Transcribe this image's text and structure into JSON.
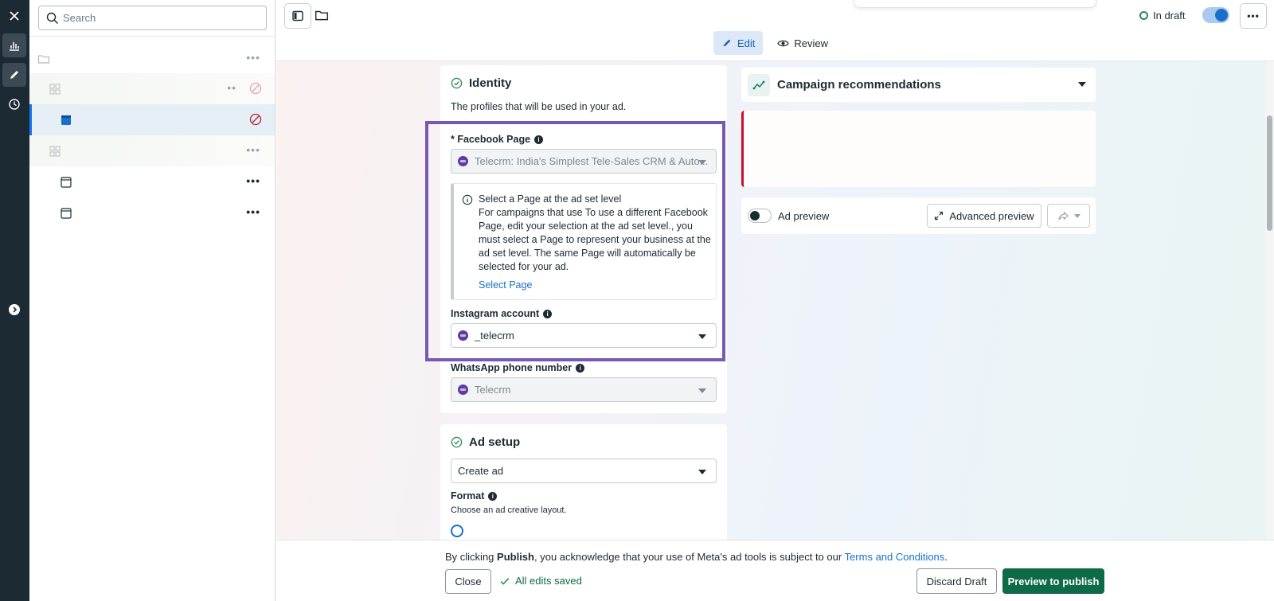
{
  "tree": {
    "search_placeholder": "Search"
  },
  "topbar": {
    "status": "In draft",
    "tabs": [
      {
        "label": "Edit"
      },
      {
        "label": "Review"
      }
    ]
  },
  "identity": {
    "title": "Identity",
    "subtitle": "The profiles that will be used in your ad.",
    "facebook_page_label": "* Facebook Page",
    "facebook_page_value": "Telecrm: India's Simplest Tele-Sales CRM & Auto...",
    "notice_title": "Select a Page at the ad set level",
    "notice_body": "For campaigns that use To use a different Facebook Page, edit your selection at the ad set level., you must select a Page to represent your business at the ad set level. The same Page will automatically be selected for your ad.",
    "notice_link": "Select Page",
    "instagram_label": "Instagram account",
    "instagram_value": "_telecrm",
    "whatsapp_label": "WhatsApp phone number",
    "whatsapp_value": "Telecrm"
  },
  "ad_setup": {
    "title": "Ad setup",
    "select_value": "Create ad",
    "format_label": "Format",
    "format_hint": "Choose an ad creative layout."
  },
  "right": {
    "recommendations_title": "Campaign recommendations",
    "ad_preview_label": "Ad preview",
    "advanced_preview_label": "Advanced preview"
  },
  "footer": {
    "notice_prefix": "By clicking ",
    "notice_bold": "Publish",
    "notice_middle": ", you acknowledge that your use of Meta's ad tools is subject to our ",
    "notice_link": "Terms and Conditions",
    "notice_end": ".",
    "close_label": "Close",
    "saved_label": "All edits saved",
    "discard_label": "Discard Draft",
    "publish_label": "Preview to publish"
  },
  "colors": {
    "highlight": "#7559b4",
    "primary": "#0e6b47",
    "accent": "#1a6fc9",
    "rail": "#1c2b33"
  }
}
